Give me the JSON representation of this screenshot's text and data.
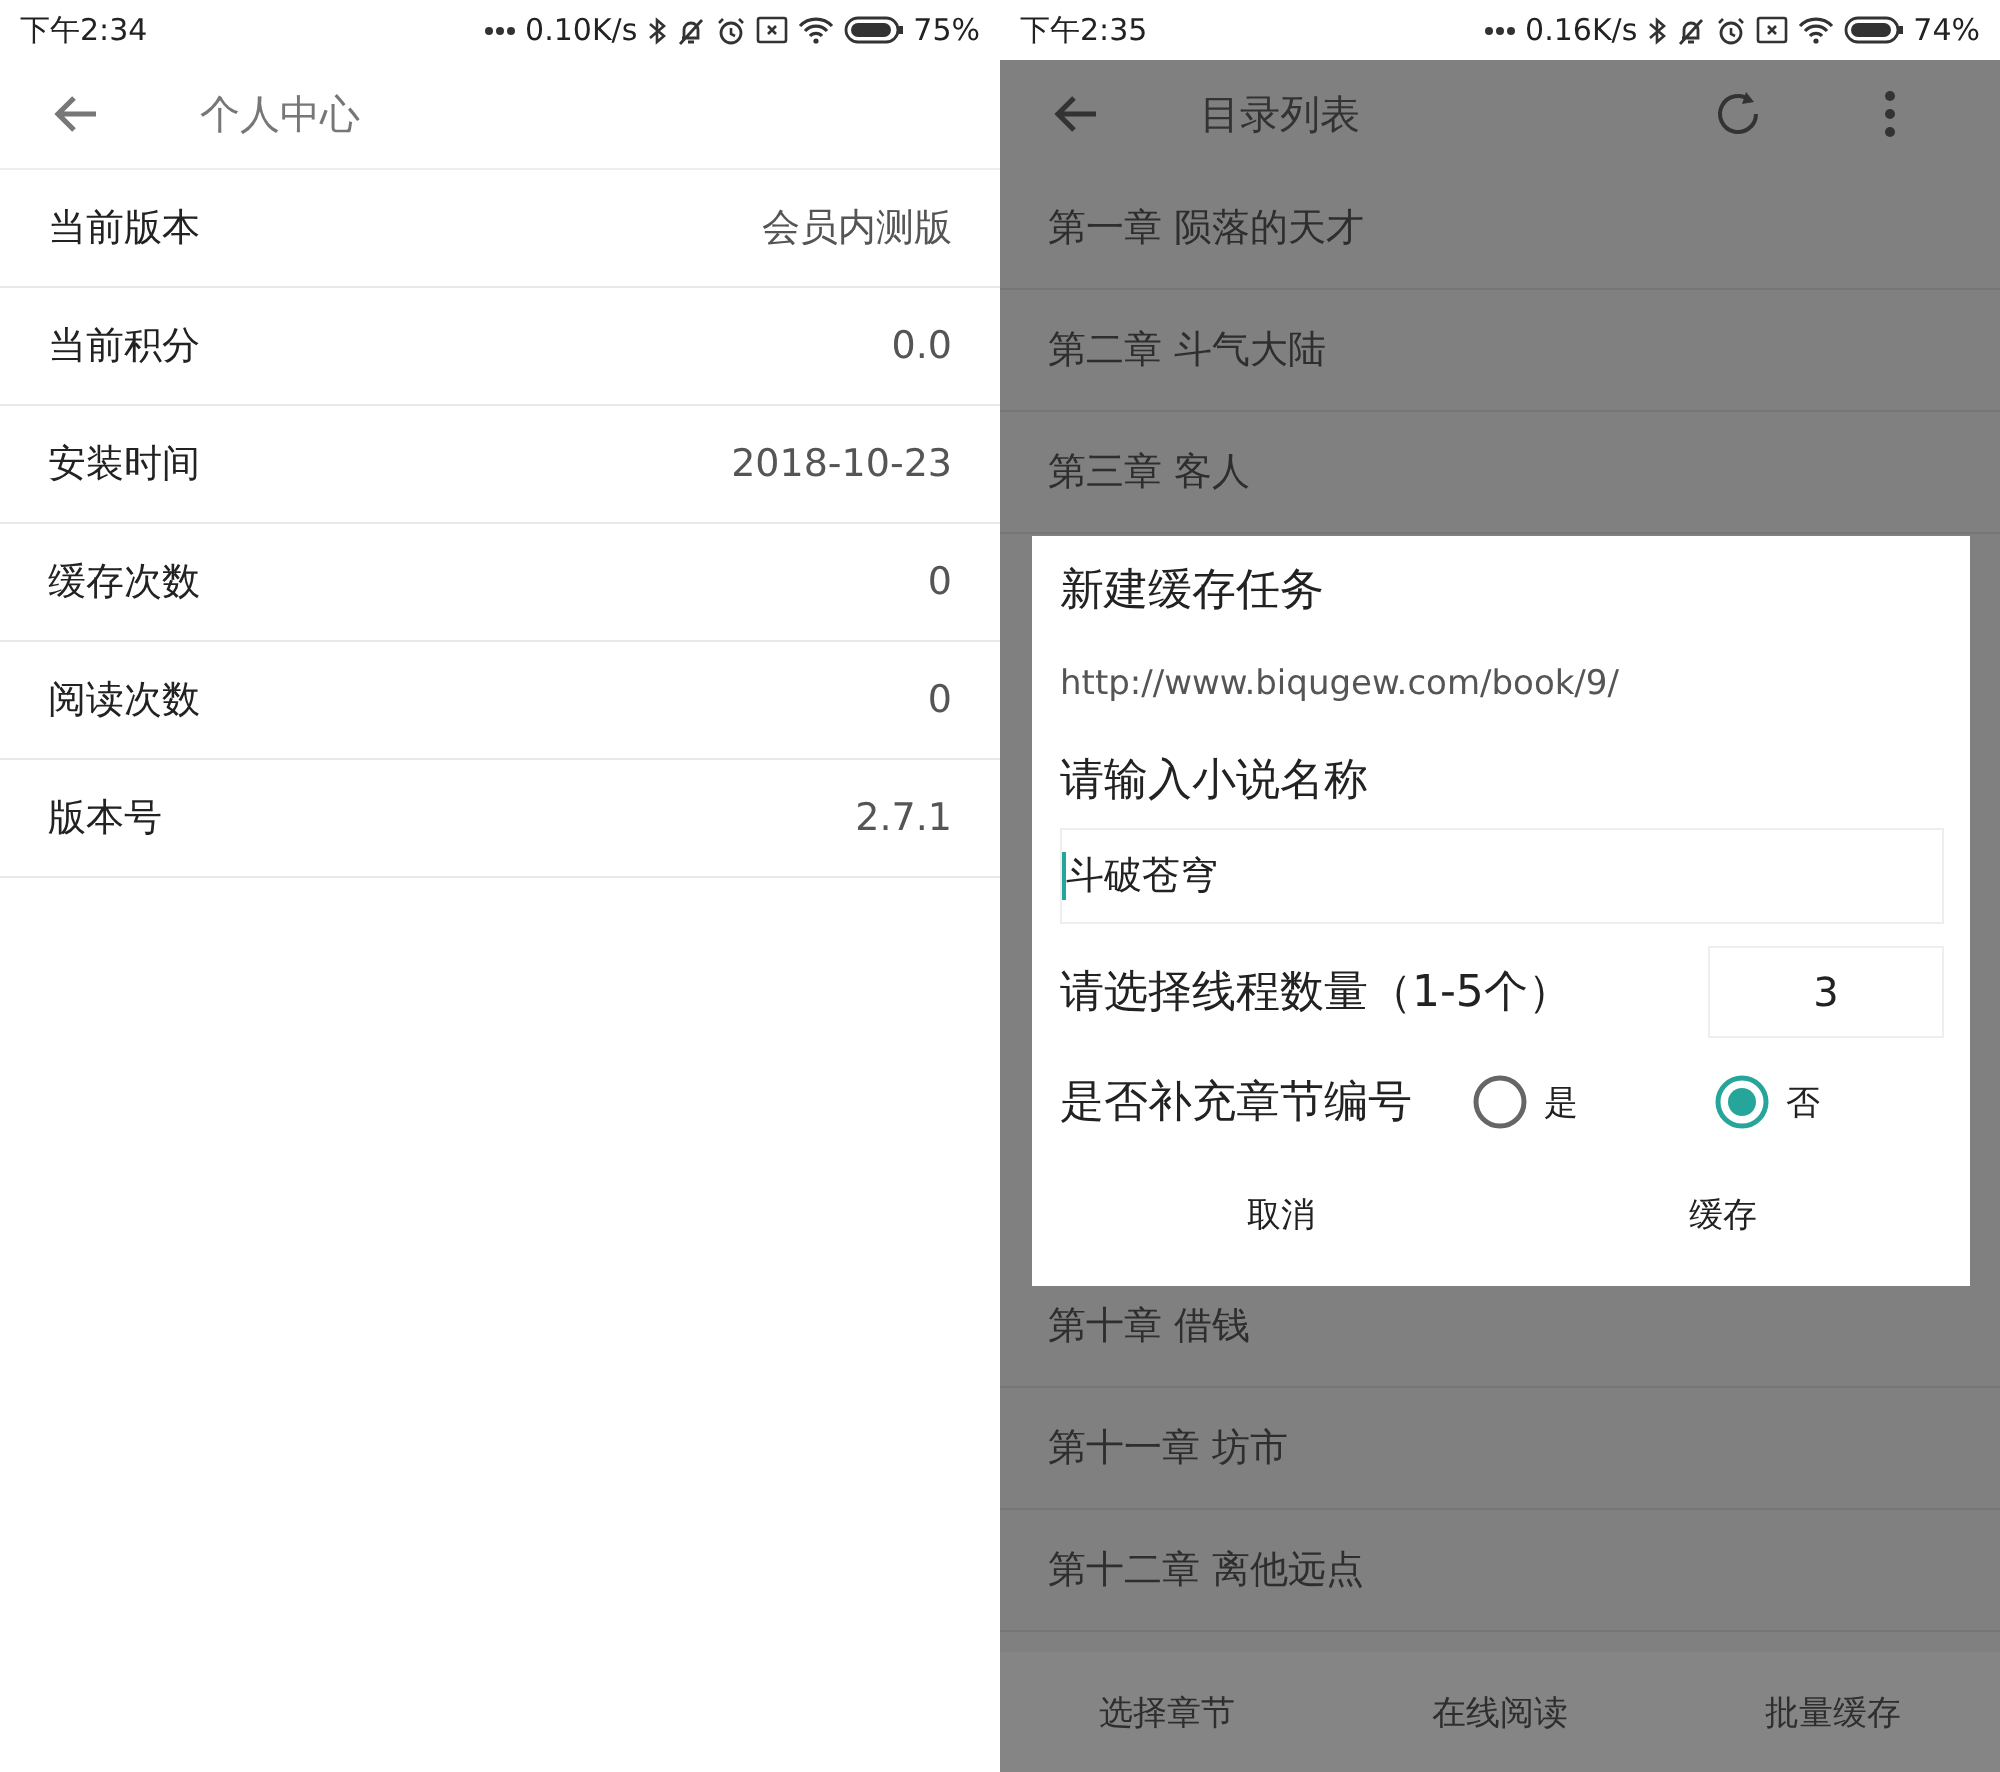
{
  "left_screen": {
    "status_bar": {
      "time": "下午2:34",
      "speed": "0.10K/s",
      "battery": "75%"
    },
    "app_bar": {
      "title": "个人中心"
    },
    "rows": [
      {
        "label": "当前版本",
        "value": "会员内测版"
      },
      {
        "label": "当前积分",
        "value": "0.0"
      },
      {
        "label": "安装时间",
        "value": "2018-10-23"
      },
      {
        "label": "缓存次数",
        "value": "0"
      },
      {
        "label": "阅读次数",
        "value": "0"
      },
      {
        "label": "版本号",
        "value": "2.7.1"
      }
    ]
  },
  "right_screen": {
    "status_bar": {
      "time": "下午2:35",
      "speed": "0.16K/s",
      "battery": "74%"
    },
    "app_bar": {
      "title": "目录列表"
    },
    "chapters_above": [
      "第一章 陨落的天才",
      "第二章 斗气大陆",
      "第三章 客人"
    ],
    "chapters_below": [
      "第十章 借钱",
      "第十一章 坊市",
      "第十二章 离他远点"
    ],
    "dialog": {
      "title": "新建缓存任务",
      "url": "http://www.biqugew.com/book/9/",
      "name_label": "请输入小说名称",
      "name_value": "斗破苍穹",
      "thread_label": "请选择线程数量（1-5个）",
      "thread_value": "3",
      "number_label": "是否补充章节编号",
      "options": [
        {
          "label": "是",
          "selected": false
        },
        {
          "label": "否",
          "selected": true
        }
      ],
      "buttons": [
        "取消",
        "缓存"
      ]
    },
    "bottom_bar": [
      "选择章节",
      "在线阅读",
      "批量缓存"
    ]
  }
}
